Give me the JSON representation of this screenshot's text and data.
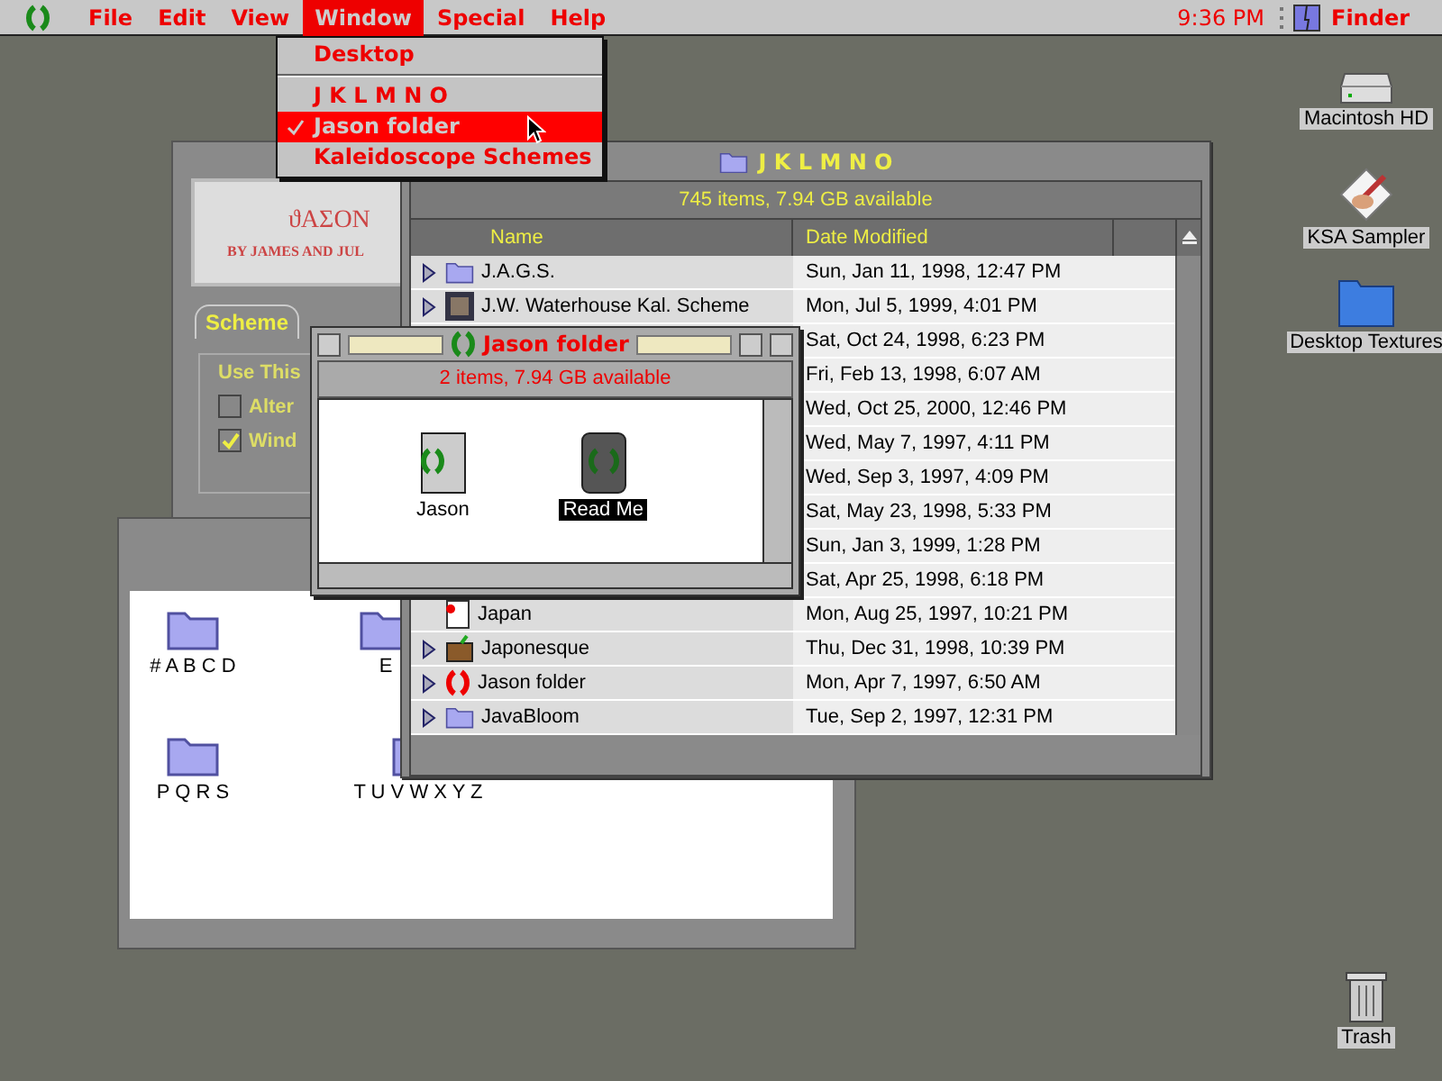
{
  "menu_bar": {
    "items": [
      {
        "label": "File",
        "selected": false
      },
      {
        "label": "Edit",
        "selected": false
      },
      {
        "label": "View",
        "selected": false
      },
      {
        "label": "Window",
        "selected": true
      },
      {
        "label": "Special",
        "selected": false
      },
      {
        "label": "Help",
        "selected": false
      }
    ],
    "clock": "9:36 PM",
    "app": "Finder"
  },
  "window_menu": {
    "items": [
      {
        "kind": "item",
        "label": "Desktop",
        "checked": false,
        "selected": false
      },
      {
        "kind": "separator"
      },
      {
        "kind": "item",
        "label": "J K L M N O",
        "checked": false,
        "selected": false
      },
      {
        "kind": "item",
        "label": "Jason folder",
        "checked": true,
        "selected": true
      },
      {
        "kind": "item",
        "label": "Kaleidoscope Schemes",
        "checked": false,
        "selected": false
      }
    ]
  },
  "desktop_icons": [
    {
      "label": "Macintosh HD",
      "kind": "drive"
    },
    {
      "label": "KSA Sampler",
      "kind": "app"
    },
    {
      "label": "Desktop Textures",
      "kind": "folder"
    },
    {
      "label": "Trash",
      "kind": "trash"
    }
  ],
  "scheme_window": {
    "banner_title": "ϑΑΣΟΝ",
    "banner_subtitle": "BY JAMES AND JUL",
    "tab": "Scheme",
    "group_label": "Use This",
    "checkboxes": [
      {
        "label": "Alter",
        "checked": false
      },
      {
        "label": "Wind",
        "checked": true
      }
    ]
  },
  "alphabet_window": {
    "items": [
      {
        "label": "# A B C D"
      },
      {
        "label": "E"
      },
      {
        "label": "P Q R S"
      },
      {
        "label": "T U V W X Y Z"
      }
    ]
  },
  "list_window": {
    "title": "J K L M N O",
    "info": "745 items, 7.94 GB available",
    "columns": [
      "Name",
      "Date Modified"
    ],
    "rows": [
      {
        "name": "J.A.G.S.",
        "kind": "folder",
        "expandable": true,
        "date": "Sun, Jan 11, 1998, 12:47 PM"
      },
      {
        "name": "J.W. Waterhouse Kal. Scheme",
        "kind": "picture",
        "expandable": true,
        "date": "Mon, Jul 5, 1999, 4:01 PM"
      },
      {
        "date": "Sat, Oct 24, 1998, 6:23 PM"
      },
      {
        "date": "Fri, Feb 13, 1998, 6:07 AM"
      },
      {
        "date": "Wed, Oct 25, 2000, 12:46 PM"
      },
      {
        "date": "Wed, May 7, 1997, 4:11 PM"
      },
      {
        "date": "Wed, Sep 3, 1997, 4:09 PM"
      },
      {
        "date": "Sat, May 23, 1998, 5:33 PM"
      },
      {
        "date": "Sun, Jan 3, 1999, 1:28 PM"
      },
      {
        "date": "Sat, Apr 25, 1998, 6:18 PM"
      },
      {
        "name": "Japan",
        "kind": "document",
        "expandable": false,
        "date": "Mon, Aug 25, 1997, 10:21 PM"
      },
      {
        "name": "Japonesque",
        "kind": "suitcase",
        "expandable": true,
        "date": "Thu, Dec 31, 1998, 10:39 PM"
      },
      {
        "name": "Jason folder",
        "kind": "laurel",
        "expandable": true,
        "date": "Mon, Apr 7, 1997, 6:50 AM"
      },
      {
        "name": "JavaBloom",
        "kind": "folder",
        "expandable": true,
        "date": "Tue, Sep 2, 1997, 12:31 PM"
      }
    ]
  },
  "folder_window": {
    "title": "Jason folder",
    "info": "2 items, 7.94 GB available",
    "items": [
      {
        "label": "Jason",
        "kind": "document",
        "selected": false
      },
      {
        "label": "Read Me",
        "kind": "readme",
        "selected": true
      }
    ]
  }
}
